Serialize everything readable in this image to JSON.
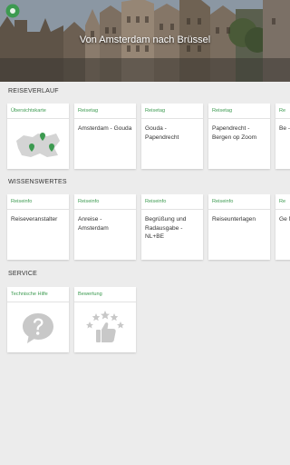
{
  "header": {
    "title": "Von Amsterdam nach Brüssel"
  },
  "sections": [
    {
      "title": "REISEVERLAUF",
      "cards": [
        {
          "label": "Übersichtskarte",
          "text": "",
          "icon": "map-icon"
        },
        {
          "label": "Reisetag",
          "text": "Amsterdam - Gouda"
        },
        {
          "label": "Reisetag",
          "text": "Gouda - Papendrecht"
        },
        {
          "label": "Reisetag",
          "text": "Papendrecht - Bergen op Zoom"
        },
        {
          "label": "Re",
          "text": "Be - A"
        }
      ]
    },
    {
      "title": "WISSENSWERTES",
      "cards": [
        {
          "label": "Reiseinfo",
          "text": "Reiseveranstalter"
        },
        {
          "label": "Reiseinfo",
          "text": "Anreise - Amsterdam"
        },
        {
          "label": "Reiseinfo",
          "text": "Begrüßung und Radausgabe - NL+BE"
        },
        {
          "label": "Reiseinfo",
          "text": "Reiseunterlagen"
        },
        {
          "label": "Re",
          "text": "Ge NL"
        }
      ]
    },
    {
      "title": "SERVICE",
      "cards": [
        {
          "label": "Technische Hilfe",
          "text": "",
          "icon": "question-bubble-icon"
        },
        {
          "label": "Bewertung",
          "text": "",
          "icon": "thumbs-up-stars-icon"
        }
      ]
    }
  ],
  "colors": {
    "accent": "#3c9a50",
    "background": "#ececec",
    "card": "#ffffff",
    "icon_gray": "#c8c8c8"
  }
}
